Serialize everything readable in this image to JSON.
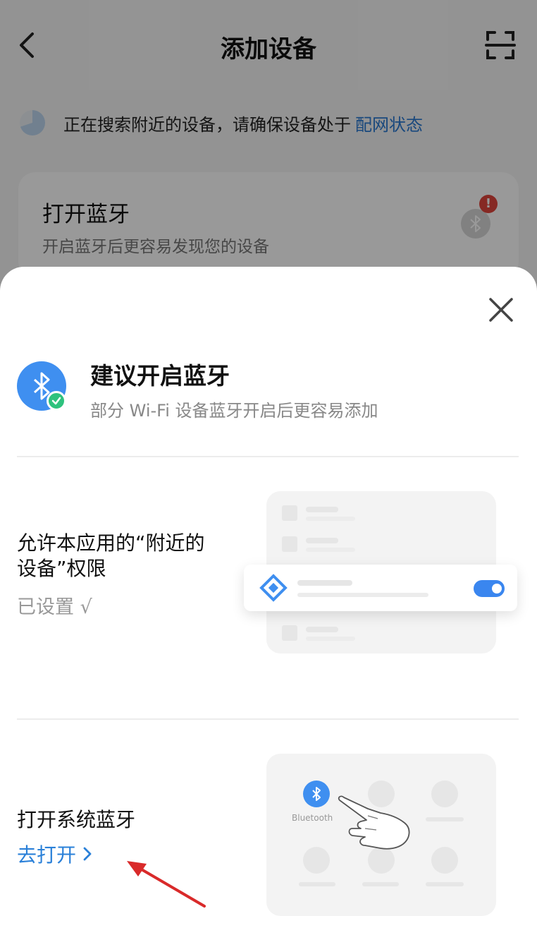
{
  "header": {
    "title": "添加设备"
  },
  "search_banner": {
    "text": "正在搜索附近的设备，请确保设备处于",
    "link": "配网状态"
  },
  "bluetooth_card": {
    "title": "打开蓝牙",
    "subtitle": "开启蓝牙后更容易发现您的设备",
    "badge": "!"
  },
  "sheet": {
    "title": "建议开启蓝牙",
    "subtitle": "部分 Wi-Fi 设备蓝牙开启后更容易添加",
    "permission": {
      "label": "允许本应用的“附近的设备”权限",
      "status": "已设置 √"
    },
    "system_bluetooth": {
      "label": "打开系统蓝牙",
      "action": "去打开"
    },
    "illustration": {
      "bluetooth_label": "Bluetooth"
    }
  },
  "colors": {
    "accent": "#2a80d8",
    "bluetooth_blue": "#3f8ff0",
    "success_green": "#2ec27e",
    "alert_red": "#e0453d",
    "arrow_red": "#d92a2a"
  },
  "icons": [
    "back-arrow-icon",
    "scan-icon",
    "bluetooth-icon",
    "alert-icon",
    "close-icon",
    "check-icon",
    "chevron-right-icon",
    "hand-pointer-icon",
    "diamond-icon"
  ]
}
